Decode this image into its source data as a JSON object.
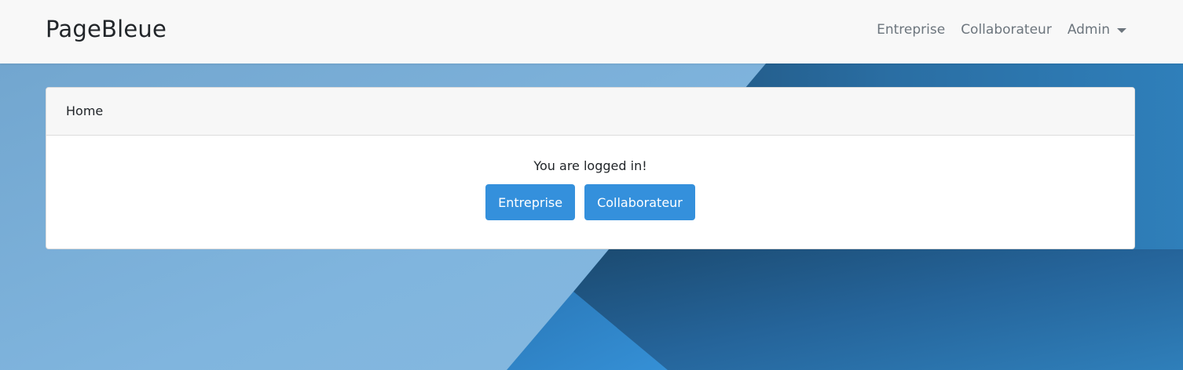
{
  "navbar": {
    "brand": "PageBleue",
    "links": {
      "entreprise": "Entreprise",
      "collaborateur": "Collaborateur",
      "admin": "Admin"
    }
  },
  "card": {
    "header": "Home",
    "status": "You are logged in!",
    "buttons": {
      "entreprise": "Entreprise",
      "collaborateur": "Collaborateur"
    }
  },
  "colors": {
    "primary": "#3490dc",
    "navbar_bg": "#f8f8f8",
    "background_blue": "#2f7fba"
  },
  "icons": {
    "admin_dropdown": "caret-down-icon"
  }
}
